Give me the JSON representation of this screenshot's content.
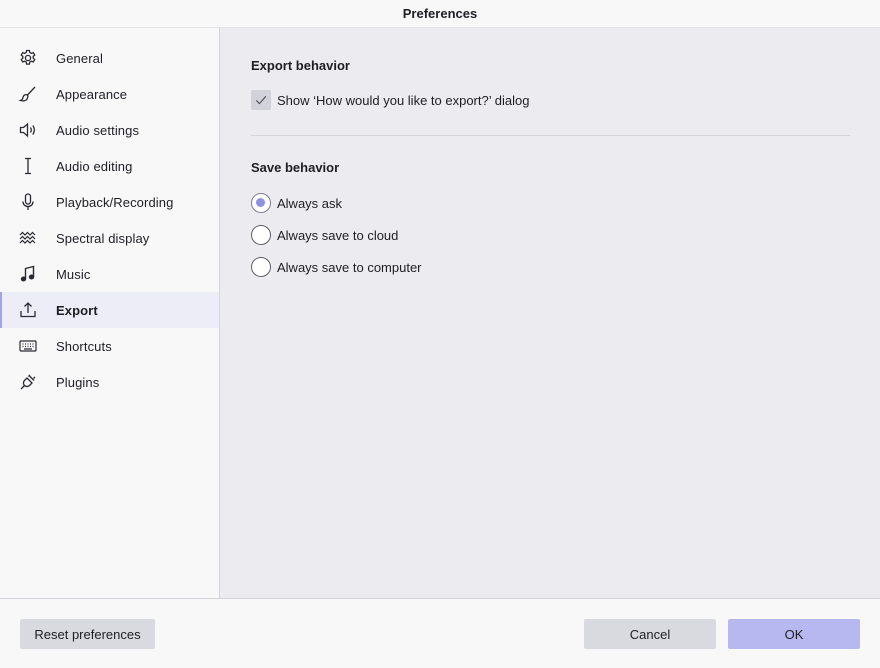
{
  "window": {
    "title": "Preferences"
  },
  "sidebar": {
    "items": [
      {
        "label": "General",
        "icon": "gear-icon"
      },
      {
        "label": "Appearance",
        "icon": "brush-icon"
      },
      {
        "label": "Audio settings",
        "icon": "speaker-icon"
      },
      {
        "label": "Audio editing",
        "icon": "text-cursor-icon"
      },
      {
        "label": "Playback/Recording",
        "icon": "microphone-icon"
      },
      {
        "label": "Spectral display",
        "icon": "waves-icon"
      },
      {
        "label": "Music",
        "icon": "music-note-icon"
      },
      {
        "label": "Export",
        "icon": "upload-icon",
        "active": true
      },
      {
        "label": "Shortcuts",
        "icon": "keyboard-icon"
      },
      {
        "label": "Plugins",
        "icon": "plug-icon"
      }
    ]
  },
  "export": {
    "title": "Export behavior",
    "show_dialog_label": "Show ‘How would you like to export?’ dialog",
    "show_dialog_checked": true
  },
  "save": {
    "title": "Save behavior",
    "options": [
      {
        "label": "Always ask",
        "selected": true
      },
      {
        "label": "Always save to cloud",
        "selected": false
      },
      {
        "label": "Always save to computer",
        "selected": false
      }
    ]
  },
  "footer": {
    "reset_label": "Reset preferences",
    "cancel_label": "Cancel",
    "ok_label": "OK"
  },
  "colors": {
    "accent": "#9090e0",
    "active_item_bg": "#ededf8",
    "ok_button": "#b8b8f0",
    "secondary_button": "#d9d9e0"
  }
}
